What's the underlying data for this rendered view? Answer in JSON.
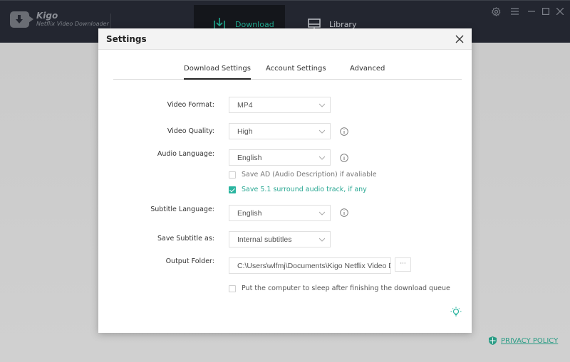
{
  "app": {
    "name": "Kigo",
    "subtitle": "Netflix Video Downloader",
    "nav": [
      {
        "label": "Download",
        "icon": "download-icon",
        "active": true
      },
      {
        "label": "Library",
        "icon": "monitor-icon",
        "active": false
      }
    ],
    "window_controls": [
      "settings-icon",
      "menu-icon",
      "minimize-icon",
      "maximize-icon",
      "close-icon"
    ],
    "privacy_label": "PRIVACY POLICY"
  },
  "dialog": {
    "title": "Settings",
    "tabs": [
      {
        "label": "Download Settings",
        "active": true
      },
      {
        "label": "Account Settings",
        "active": false
      },
      {
        "label": "Advanced",
        "active": false
      }
    ],
    "fields": {
      "video_format": {
        "label": "Video Format:",
        "value": "MP4"
      },
      "video_quality": {
        "label": "Video Quality:",
        "value": "High"
      },
      "audio_language": {
        "label": "Audio Language:",
        "value": "English"
      },
      "subtitle_language": {
        "label": "Subtitle Language:",
        "value": "English"
      },
      "save_subtitle": {
        "label": "Save Subtitle as:",
        "value": "Internal subtitles"
      },
      "output_folder": {
        "label": "Output Folder:",
        "value": "C:\\Users\\wlfmj\\Documents\\Kigo Netflix Video D",
        "browse_label": "···"
      }
    },
    "checkboxes": {
      "save_ad": {
        "label": "Save AD (Audio Description) if avaliable",
        "checked": false
      },
      "save_51": {
        "label": "Save 5.1 surround audio track, if any",
        "checked": true
      },
      "sleep": {
        "label": "Put the computer to sleep after finishing the download queue",
        "checked": false
      }
    }
  },
  "colors": {
    "accent": "#2bb5a0",
    "titlebar": "#232630"
  }
}
